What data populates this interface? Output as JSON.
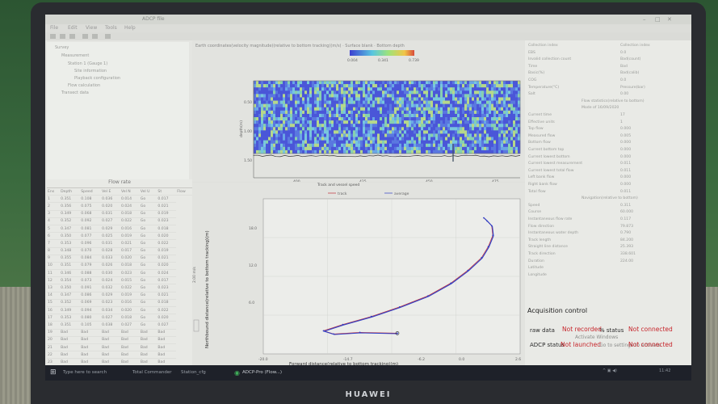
{
  "window": {
    "title": "ADCP file",
    "menu": [
      "File",
      "Edit",
      "View",
      "Tools",
      "Help"
    ]
  },
  "tree": {
    "items": [
      "Survey",
      "Measurement",
      "Station 1 (Gauge 1)",
      "Site information",
      "Playback configuration",
      "Flow calculation",
      "Transect data"
    ]
  },
  "flow_table": {
    "title": "Flow rate",
    "headers": [
      "Ens",
      "Depth",
      "Speed",
      "Vel E",
      "Vel N",
      "Vel U",
      "St",
      "Flow"
    ],
    "rows": [
      [
        "1",
        "0.351",
        "0.108",
        "0.036",
        "0.014",
        "Go",
        "0.017"
      ],
      [
        "2",
        "0.356",
        "0.075",
        "0.020",
        "0.024",
        "Go",
        "0.021"
      ],
      [
        "3",
        "0.349",
        "0.068",
        "0.031",
        "0.018",
        "Go",
        "0.019"
      ],
      [
        "4",
        "0.352",
        "0.092",
        "0.027",
        "0.022",
        "Go",
        "0.023"
      ],
      [
        "5",
        "0.347",
        "0.081",
        "0.029",
        "0.016",
        "Go",
        "0.018"
      ],
      [
        "6",
        "0.350",
        "0.077",
        "0.025",
        "0.019",
        "Go",
        "0.020"
      ],
      [
        "7",
        "0.353",
        "0.096",
        "0.031",
        "0.021",
        "Go",
        "0.022"
      ],
      [
        "8",
        "0.348",
        "0.070",
        "0.028",
        "0.017",
        "Go",
        "0.019"
      ],
      [
        "9",
        "0.355",
        "0.084",
        "0.033",
        "0.020",
        "Go",
        "0.021"
      ],
      [
        "10",
        "0.351",
        "0.079",
        "0.026",
        "0.018",
        "Go",
        "0.020"
      ],
      [
        "11",
        "0.346",
        "0.088",
        "0.030",
        "0.023",
        "Go",
        "0.024"
      ],
      [
        "12",
        "0.354",
        "0.073",
        "0.024",
        "0.015",
        "Go",
        "0.017"
      ],
      [
        "13",
        "0.350",
        "0.091",
        "0.032",
        "0.022",
        "Go",
        "0.023"
      ],
      [
        "14",
        "0.347",
        "0.086",
        "0.029",
        "0.019",
        "Go",
        "0.021"
      ],
      [
        "15",
        "0.352",
        "0.069",
        "0.023",
        "0.016",
        "Go",
        "0.018"
      ],
      [
        "16",
        "0.349",
        "0.094",
        "0.034",
        "0.020",
        "Go",
        "0.022"
      ],
      [
        "17",
        "0.353",
        "0.080",
        "0.027",
        "0.018",
        "Go",
        "0.020"
      ],
      [
        "18",
        "0.351",
        "0.105",
        "0.038",
        "0.027",
        "Go",
        "0.027"
      ],
      [
        "19",
        "Bad",
        "Bad",
        "Bad",
        "Bad",
        "Bad",
        "Bad"
      ],
      [
        "20",
        "Bad",
        "Bad",
        "Bad",
        "Bad",
        "Bad",
        "Bad"
      ],
      [
        "21",
        "Bad",
        "Bad",
        "Bad",
        "Bad",
        "Bad",
        "Bad"
      ],
      [
        "22",
        "Bad",
        "Bad",
        "Bad",
        "Bad",
        "Bad",
        "Bad"
      ],
      [
        "23",
        "Bad",
        "Bad",
        "Bad",
        "Bad",
        "Bad",
        "Bad"
      ],
      [
        "24",
        "Bad",
        "Bad",
        "Bad",
        "Bad",
        "Bad",
        "Bad"
      ],
      [
        "25",
        "Bad",
        "Bad",
        "Bad",
        "Bad",
        "Bad",
        "Bad"
      ]
    ]
  },
  "contour": {
    "title": "Earth coordinates(velocity magnitude)(relative to bottom tracking)(m/s) · Surface blank · Bottom depth",
    "colorbar_ticks": [
      "0.004",
      "0.341",
      "0.739"
    ],
    "y_label": "depth(m)",
    "y_ticks": [
      "0.50",
      "1.00",
      "1.50"
    ],
    "x_ticks": [
      "400",
      "425",
      "450",
      "475"
    ],
    "x_label": "Data group number"
  },
  "track": {
    "legend_title": "Track and vessel speed",
    "legend_track": "track",
    "legend_average": "average",
    "y_label": "Northbound distance(relative to bottom tracking)(m)",
    "y_ticks": [
      "18.0",
      "12.0",
      "6.0"
    ],
    "x_label": "Forward distance(relative to bottom tracking)(m)",
    "x_ticks": [
      "-20.0",
      "-14.7",
      "-6.2",
      "0.0",
      "2.6"
    ],
    "scale_label": "2.00 m/s"
  },
  "chart_data": [
    {
      "type": "heatmap",
      "title": "Earth coordinates(velocity magnitude)(relative to bottom tracking)(m/s) · Surface blank · Bottom depth",
      "xlabel": "Data group number",
      "ylabel": "depth(m)",
      "xlim": [
        390,
        480
      ],
      "ylim": [
        1.7,
        0.3
      ],
      "colorbar_range": [
        0.004,
        0.739
      ]
    },
    {
      "type": "line",
      "title": "Track and vessel speed",
      "xlabel": "Forward distance(relative to bottom tracking)(m)",
      "ylabel": "Northbound distance(relative to bottom tracking)(m)",
      "series": [
        {
          "name": "track",
          "x": [
            -8.2,
            -11.5,
            -13.8,
            -14.7,
            -13.0,
            -10.5,
            -8.0,
            -5.5,
            -3.5,
            -2.0,
            -0.8,
            -0.2,
            0.2,
            0.1,
            -0.3,
            -0.6
          ],
          "y": [
            3.1,
            3.2,
            3.0,
            3.4,
            4.2,
            5.2,
            6.4,
            7.8,
            9.4,
            11.0,
            12.6,
            14.0,
            15.4,
            16.6,
            17.2,
            17.6
          ]
        }
      ],
      "xlim": [
        -20,
        2.6
      ],
      "ylim": [
        0.5,
        20
      ]
    }
  ],
  "properties": {
    "rows": [
      {
        "label": "Collection index",
        "value": "Collection index"
      },
      {
        "label": "EBS",
        "value": "0.0"
      },
      {
        "label": "Invalid collection count",
        "value": "Bad(count)"
      },
      {
        "label": "Time",
        "value": "Bad"
      },
      {
        "label": "Basic(%)",
        "value": "Bad(calib)"
      },
      {
        "label": "COG",
        "value": "0.0"
      },
      {
        "label": "Temperature(°C)",
        "value": "Pressure(bar)"
      },
      {
        "label": "Salt",
        "value": "0.00"
      },
      {
        "label": "",
        "value": "Flow statistics(relative to bottom)"
      },
      {
        "label": "",
        "value": "Mode of 16/09/2020"
      },
      {
        "label": "Current time",
        "value": "17"
      },
      {
        "label": "Effective units",
        "value": "1"
      },
      {
        "label": "Top flow",
        "value": "0.000"
      },
      {
        "label": "Measured flow",
        "value": "0.005"
      },
      {
        "label": "Bottom flow",
        "value": "0.000"
      },
      {
        "label": "Current bottom top",
        "value": "0.000"
      },
      {
        "label": "Current lowest bottom",
        "value": "0.000"
      },
      {
        "label": "Current lowest measurement",
        "value": "0.011"
      },
      {
        "label": "Current lowest total flow",
        "value": "0.011"
      },
      {
        "label": "Left bank flow",
        "value": "0.000"
      },
      {
        "label": "Right bank flow",
        "value": "0.000"
      },
      {
        "label": "Total flow",
        "value": "0.011"
      },
      {
        "label": "",
        "value": "Navigation(relative to bottom)"
      },
      {
        "label": "Speed",
        "value": "0.311"
      },
      {
        "label": "Course",
        "value": "60.000"
      },
      {
        "label": "Instantaneous flow rate",
        "value": "0.117"
      },
      {
        "label": "Flow direction",
        "value": "79.873"
      },
      {
        "label": "Instantaneous water depth",
        "value": "0.790"
      },
      {
        "label": "Track length",
        "value": "84.200"
      },
      {
        "label": "Straight line distance",
        "value": "25.393"
      },
      {
        "label": "Track direction",
        "value": "338.601"
      },
      {
        "label": "Duration",
        "value": "224.00"
      },
      {
        "label": "Latitude",
        "value": ""
      },
      {
        "label": "Longitude",
        "value": ""
      }
    ]
  },
  "acquisition": {
    "title": "Acquisition control",
    "raw_data_label": "raw data",
    "raw_data_status": "Not recorded",
    "gps_status_label": "% status",
    "gps_status": "Not connected",
    "adcp_status_label": "ADCP status",
    "adcp_status": "Not launched",
    "adcp_status2": "Not connected",
    "faint_note": "Activate Windows",
    "faint_note2": "Go to settings to activate"
  },
  "taskbar": {
    "search": "Type here to search",
    "apps": [
      "Total Commander",
      "Station_cfg",
      "ADCP-Pro (Flow...)"
    ],
    "tray": "11:42"
  },
  "brand": "HUAWEI",
  "colors": {
    "accent_red": "#c7252b",
    "track_blue": "#3040c8"
  }
}
